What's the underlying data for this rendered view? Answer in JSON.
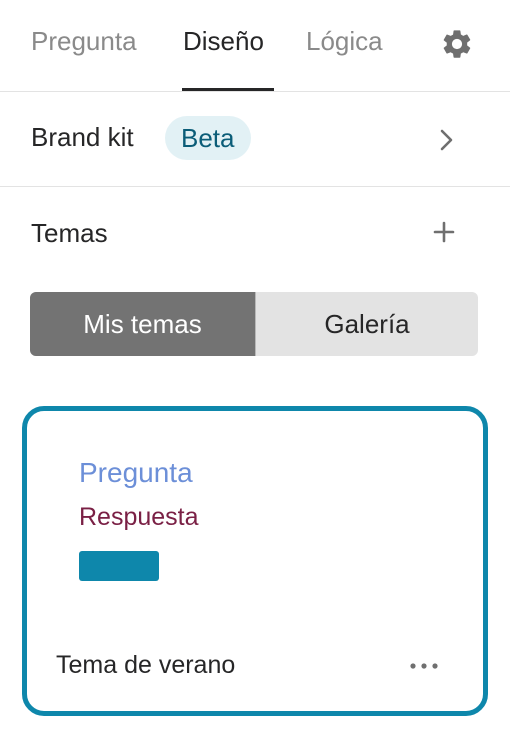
{
  "tabs": [
    {
      "label": "Pregunta",
      "active": false
    },
    {
      "label": "Diseño",
      "active": true
    },
    {
      "label": "Lógica",
      "active": false
    }
  ],
  "brand_kit": {
    "label": "Brand kit",
    "badge": "Beta"
  },
  "themes": {
    "label": "Temas",
    "segments": [
      {
        "label": "Mis temas",
        "selected": true
      },
      {
        "label": "Galería",
        "selected": false
      }
    ],
    "card": {
      "question_text": "Pregunta",
      "answer_text": "Respuesta",
      "name": "Tema de verano",
      "question_color": "#6c8fd8",
      "answer_color": "#7a2045",
      "button_color": "#0e87ab",
      "selected": true
    }
  },
  "icons": {
    "settings": "gear-icon",
    "brand_kit_open": "chevron-right-icon",
    "add_theme": "plus-icon",
    "theme_options": "more-horizontal-icon"
  }
}
